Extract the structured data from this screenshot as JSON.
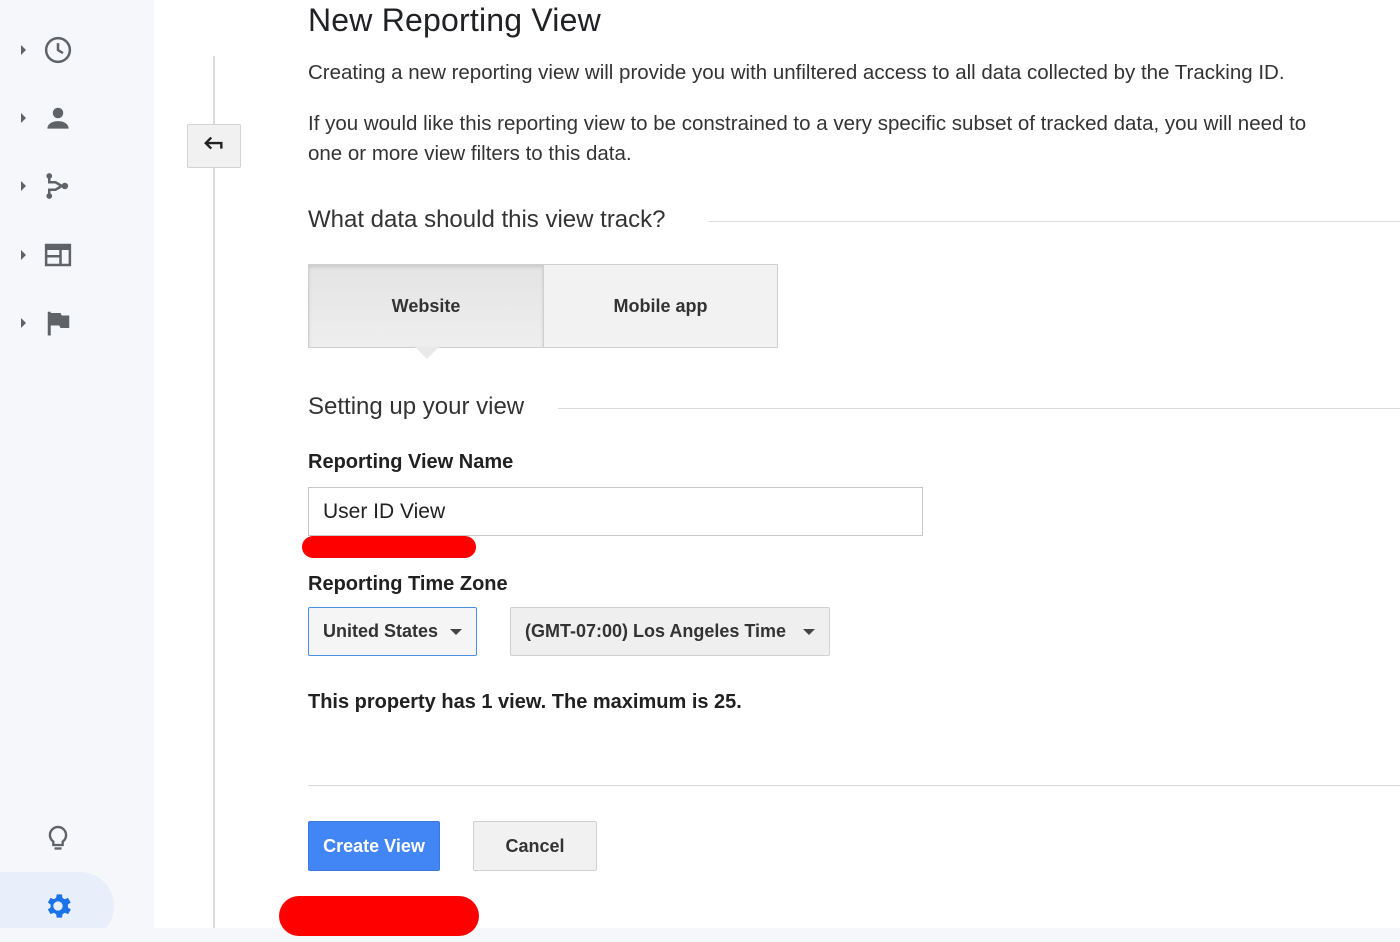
{
  "sidebar": {
    "items": [
      {
        "icon": "clock-icon"
      },
      {
        "icon": "person-icon"
      },
      {
        "icon": "acquisition-icon"
      },
      {
        "icon": "behavior-icon"
      },
      {
        "icon": "flag-icon"
      }
    ],
    "bottom": {
      "insights_icon": "lightbulb-icon",
      "admin_icon": "gear-icon"
    },
    "active_color": "#1a73e8",
    "icon_color": "#5f6368"
  },
  "back_icon": "back-arrow-icon",
  "main": {
    "title": "New Reporting View",
    "intro": "Creating a new reporting view will provide you with unfiltered access to all data collected by the Tracking ID.",
    "filter_note_line1": "If you would like this reporting view to be constrained to a very specific subset of tracked data, you will need to",
    "filter_note_line2": "one or more view filters to this data.",
    "track_heading": "What data should this view track?",
    "tabs": [
      {
        "label": "Website",
        "selected": true
      },
      {
        "label": "Mobile app",
        "selected": false
      }
    ],
    "setup_heading": "Setting up your view",
    "view_name": {
      "label": "Reporting View Name",
      "value": "User ID View"
    },
    "time_zone": {
      "label": "Reporting Time Zone",
      "country": "United States",
      "zone": "(GMT-07:00) Los Angeles Time"
    },
    "views_info": "This property has 1 view. The maximum is 25.",
    "buttons": {
      "create": "Create View",
      "cancel": "Cancel"
    }
  },
  "colors": {
    "primary_button": "#4285f4",
    "annotation": "#ff0000"
  }
}
